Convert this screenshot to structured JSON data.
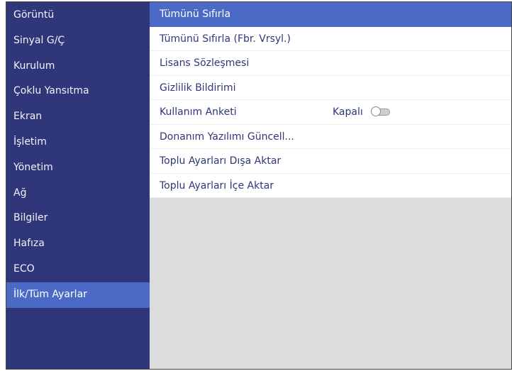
{
  "sidebar": {
    "items": [
      {
        "label": "Görüntü"
      },
      {
        "label": "Sinyal G/Ç"
      },
      {
        "label": "Kurulum"
      },
      {
        "label": "Çoklu Yansıtma"
      },
      {
        "label": "Ekran"
      },
      {
        "label": "İşletim"
      },
      {
        "label": "Yönetim"
      },
      {
        "label": "Ağ"
      },
      {
        "label": "Bilgiler"
      },
      {
        "label": "Hafıza"
      },
      {
        "label": "ECO"
      },
      {
        "label": "İlk/Tüm Ayarlar",
        "active": true
      }
    ]
  },
  "main": {
    "items": [
      {
        "label": "Tümünü Sıfırla",
        "selected": true
      },
      {
        "label": "Tümünü Sıfırla (Fbr. Vrsyl.)"
      },
      {
        "label": "Lisans Sözleşmesi"
      },
      {
        "label": "Gizlilik Bildirimi"
      },
      {
        "label": "Kullanım Anketi",
        "value": "Kapalı",
        "toggle_on": false
      },
      {
        "label": "Donanım Yazılımı Güncell..."
      },
      {
        "label": "Toplu Ayarları Dışa Aktar"
      },
      {
        "label": "Toplu Ayarları İçe Aktar"
      }
    ]
  },
  "colors": {
    "sidebar_bg": "#2f3679",
    "highlight": "#4a6ac6",
    "content_bg": "#dcdcdc",
    "text_primary": "#2f3679"
  }
}
